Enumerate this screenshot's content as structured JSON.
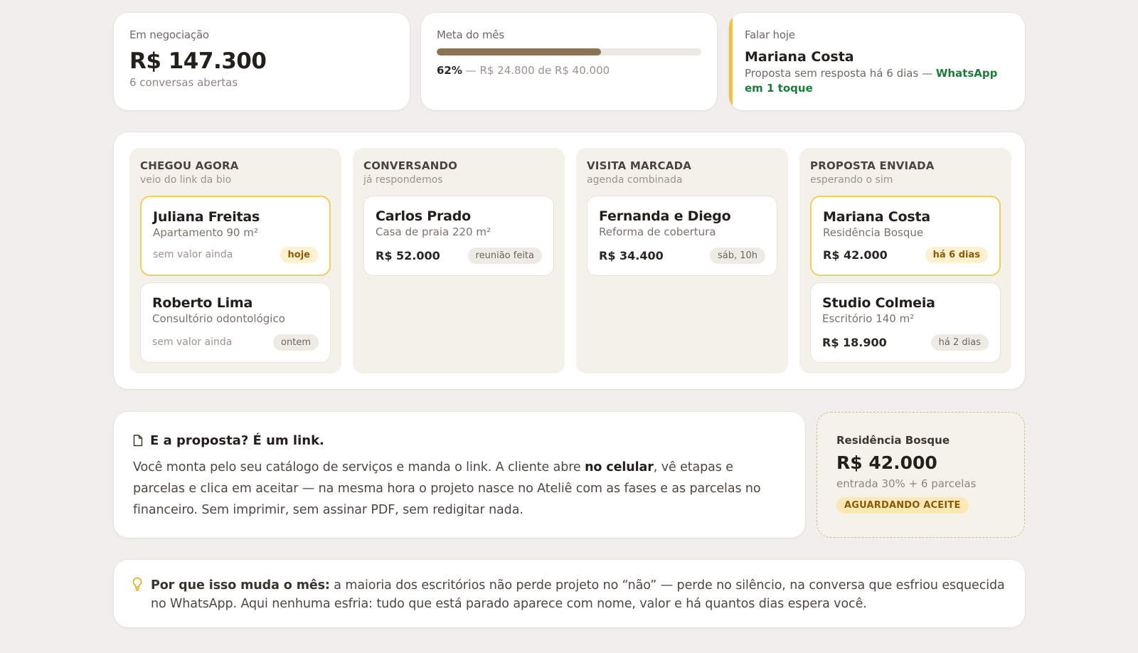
{
  "kpis": {
    "negotiation": {
      "label": "Em negociação",
      "value": "R$ 147.300",
      "sub": "6 conversas abertas"
    },
    "goal": {
      "label": "Meta do mês",
      "percent_text": "62%",
      "progress": 0.62,
      "detail": " — R$ 24.800 de R$ 40.000"
    },
    "talk_today": {
      "label": "Falar hoje",
      "name": "Mariana Costa",
      "desc": "Proposta sem resposta há 6 dias — ",
      "action": "WhatsApp em 1 toque"
    }
  },
  "board": {
    "columns": [
      {
        "title": "CHEGOU AGORA",
        "subtitle": "veio do link da bio",
        "deals": [
          {
            "name": "Juliana Freitas",
            "desc": "Apartamento 90 m²",
            "value": "sem valor ainda",
            "badge": "hoje",
            "highlight": true
          },
          {
            "name": "Roberto Lima",
            "desc": "Consultório odontológico",
            "value": "sem valor ainda",
            "badge": "ontem",
            "highlight": false
          }
        ]
      },
      {
        "title": "CONVERSANDO",
        "subtitle": "já respondemos",
        "deals": [
          {
            "name": "Carlos Prado",
            "desc": "Casa de praia 220 m²",
            "value": "R$ 52.000",
            "badge": "reunião feita",
            "highlight": false
          }
        ]
      },
      {
        "title": "VISITA MARCADA",
        "subtitle": "agenda combinada",
        "deals": [
          {
            "name": "Fernanda e Diego",
            "desc": "Reforma de cobertura",
            "value": "R$ 34.400",
            "badge": "sáb, 10h",
            "highlight": false
          }
        ]
      },
      {
        "title": "PROPOSTA ENVIADA",
        "subtitle": "esperando o sim",
        "deals": [
          {
            "name": "Mariana Costa",
            "desc": "Residência Bosque",
            "value": "R$ 42.000",
            "badge": "há 6 dias",
            "highlight": true
          },
          {
            "name": "Studio Colmeia",
            "desc": "Escritório 140 m²",
            "value": "R$ 18.900",
            "badge": "há 2 dias",
            "highlight": false
          }
        ]
      }
    ]
  },
  "proposal": {
    "icon": "document-icon",
    "title": "E a proposta? É um link.",
    "text_1": "Você monta pelo seu catálogo de serviços e manda o link. A cliente abre ",
    "text_bold": "no celular",
    "text_2": ", vê etapas e parcelas e clica em aceitar — na mesma hora o projeto nasce no Ateliê com as fases e as parcelas no financeiro. Sem imprimir, sem assinar PDF, sem redigitar nada."
  },
  "preview": {
    "name": "Residência Bosque",
    "value": "R$ 42.000",
    "terms": "entrada 30% + 6 parcelas",
    "status": "AGUARDANDO ACEITE"
  },
  "insight": {
    "icon": "lightbulb-icon",
    "lead": "Por que isso muda o mês:",
    "text": " a maioria dos escritórios não perde projeto no “não” — perde no silêncio, na conversa que esfriou esquecida no WhatsApp. Aqui nenhuma esfria: tudo que está parado aparece com nome, valor e há quantos dias espera você."
  },
  "colors": {
    "accent_yellow": "#f0c043",
    "progress": "#8a7452",
    "whatsapp_green": "#1f7a3e",
    "warm_badge": "#fdf1cf"
  }
}
